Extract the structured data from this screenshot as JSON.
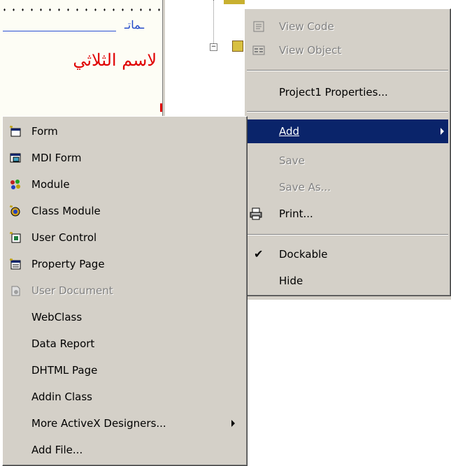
{
  "form": {
    "blue_label": "ـماتـ",
    "red_label": "لاسم الثلاثي"
  },
  "context_menu": {
    "items": [
      {
        "label": "View Code",
        "mnemonic_underlined": "o",
        "enabled": false,
        "icon": "view-code-icon"
      },
      {
        "label": "View Object",
        "mnemonic_underlined": "b",
        "enabled": false,
        "icon": "view-object-icon"
      },
      {
        "label": "Project1 Properties...",
        "enabled": true
      },
      {
        "label": "Add",
        "enabled": true,
        "highlighted": true,
        "has_submenu": true
      },
      {
        "label": "Save",
        "enabled": false
      },
      {
        "label": "Save As...",
        "enabled": false
      },
      {
        "label": "Print...",
        "enabled": true,
        "icon": "printer-icon"
      },
      {
        "label": "Dockable",
        "enabled": true,
        "checked": true
      },
      {
        "label": "Hide",
        "enabled": true
      }
    ]
  },
  "add_submenu": {
    "items": [
      {
        "label": "Form",
        "enabled": true,
        "icon": "form-icon"
      },
      {
        "label": "MDI Form",
        "enabled": true,
        "icon": "mdi-form-icon"
      },
      {
        "label": "Module",
        "enabled": true,
        "icon": "module-icon"
      },
      {
        "label": "Class Module",
        "enabled": true,
        "icon": "class-module-icon"
      },
      {
        "label": "User Control",
        "enabled": true,
        "icon": "user-control-icon"
      },
      {
        "label": "Property Page",
        "enabled": true,
        "icon": "property-page-icon"
      },
      {
        "label": "User Document",
        "enabled": false,
        "icon": "user-document-icon"
      },
      {
        "label": "WebClass",
        "enabled": true
      },
      {
        "label": "Data Report",
        "enabled": true
      },
      {
        "label": "DHTML Page",
        "enabled": true
      },
      {
        "label": "Addin Class",
        "enabled": true
      },
      {
        "label": "More ActiveX Designers...",
        "enabled": true,
        "has_submenu": true
      },
      {
        "label": "Add File...",
        "enabled": true
      }
    ]
  },
  "colors": {
    "menu_bg": "#d4d0c8",
    "highlight": "#0a246a",
    "disabled_text": "#808080",
    "red_label": "#e00000",
    "blue_label": "#1e46c8"
  }
}
